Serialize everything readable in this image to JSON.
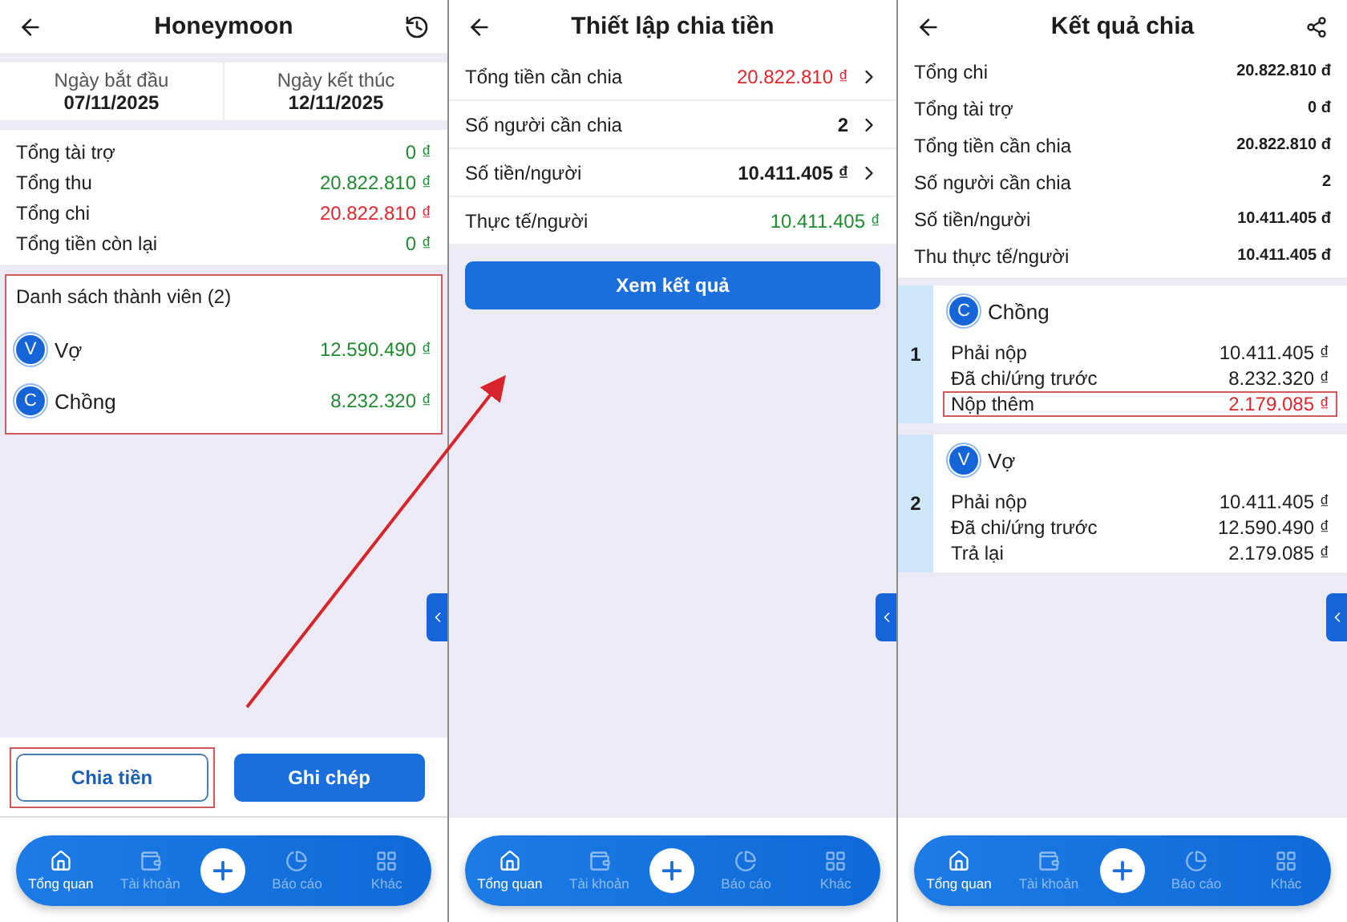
{
  "overview": {
    "title": "Honeymoon",
    "dates": [
      {
        "label": "Ngày bắt đầu",
        "value": "07/11/2025"
      },
      {
        "label": "Ngày kết thúc",
        "value": "12/11/2025"
      }
    ],
    "totals": [
      {
        "label": "Tổng tài trợ",
        "value": "0 ₫",
        "color": "#1f8a30"
      },
      {
        "label": "Tổng thu",
        "value": "20.822.810 ₫",
        "color": "#1f8a30"
      },
      {
        "label": "Tổng chi",
        "value": "20.822.810 ₫",
        "color": "#e0262b"
      },
      {
        "label": "Tổng tiền còn lại",
        "value": "0 ₫",
        "color": "#1f8a30"
      }
    ],
    "members": {
      "title": "Danh sách thành viên (2)",
      "highlighted": true,
      "items": [
        {
          "initial": "V",
          "name": "Vợ",
          "amount": "12.590.490 ₫"
        },
        {
          "initial": "C",
          "name": "Chồng",
          "amount": "8.232.320 ₫"
        }
      ]
    },
    "actions": [
      {
        "label": "Chia tiền",
        "kind": "outline",
        "highlighted": true
      },
      {
        "label": "Ghi chép",
        "kind": "filled",
        "highlighted": false
      }
    ],
    "nav": [
      {
        "label": "Tổng quan",
        "selected": true
      },
      {
        "label": "Tài khoản",
        "selected": false
      },
      {
        "label": "Báo cáo",
        "selected": false
      },
      {
        "label": "Khác",
        "selected": false
      }
    ]
  },
  "setup": {
    "title": "Thiết lập chia tiền",
    "rows": [
      {
        "label": "Tổng tiền cần chia",
        "value": "20.822.810 ₫",
        "color": "#e0262b",
        "bold": false,
        "chevron": true
      },
      {
        "label": "Số người cần chia",
        "value": "2",
        "color": "#1d1d1f",
        "bold": true,
        "chevron": true
      },
      {
        "label": "Số tiền/người",
        "value": "10.411.405 ₫",
        "color": "#1d1d1f",
        "bold": true,
        "chevron": true
      },
      {
        "label": "Thực tế/người",
        "value": "10.411.405 ₫",
        "color": "#1f8a30",
        "bold": false,
        "chevron": false
      }
    ],
    "button": "Xem kết quả",
    "nav": [
      {
        "label": "Tổng quan",
        "selected": true
      },
      {
        "label": "Tài khoản",
        "selected": false
      },
      {
        "label": "Báo cáo",
        "selected": false
      },
      {
        "label": "Khác",
        "selected": false
      }
    ]
  },
  "result": {
    "title": "Kết quả chia",
    "summary": [
      {
        "label": "Tổng chi",
        "value": "20.822.810 đ"
      },
      {
        "label": "Tổng tài trợ",
        "value": "0 đ"
      },
      {
        "label": "Tổng tiền cần chia",
        "value": "20.822.810 đ"
      },
      {
        "label": "Số người cần chia",
        "value": "2"
      },
      {
        "label": "Số tiền/người",
        "value": "10.411.405 đ"
      },
      {
        "label": "Thu thực tế/người",
        "value": "10.411.405 đ"
      }
    ],
    "people": [
      {
        "rank": "1",
        "initial": "C",
        "name": "Chồng",
        "lines": [
          {
            "label": "Phải nộp",
            "value": "10.411.405 ₫",
            "color": "#1d1d1f",
            "highlighted": false
          },
          {
            "label": "Đã chi/ứng trước",
            "value": "8.232.320 ₫",
            "color": "#1d1d1f",
            "highlighted": false
          },
          {
            "label": "Nộp thêm",
            "value": "2.179.085 ₫",
            "color": "#e0262b",
            "highlighted": true
          }
        ]
      },
      {
        "rank": "2",
        "initial": "V",
        "name": "Vợ",
        "lines": [
          {
            "label": "Phải nộp",
            "value": "10.411.405 ₫",
            "color": "#1d1d1f",
            "highlighted": false
          },
          {
            "label": "Đã chi/ứng trước",
            "value": "12.590.490 ₫",
            "color": "#1d1d1f",
            "highlighted": false
          },
          {
            "label": "Trả lại",
            "value": "2.179.085 ₫",
            "color": "#1d1d1f",
            "highlighted": false
          }
        ]
      }
    ],
    "nav": [
      {
        "label": "Tổng quan",
        "selected": true
      },
      {
        "label": "Tài khoản",
        "selected": false
      },
      {
        "label": "Báo cáo",
        "selected": false
      },
      {
        "label": "Khác",
        "selected": false
      }
    ]
  }
}
